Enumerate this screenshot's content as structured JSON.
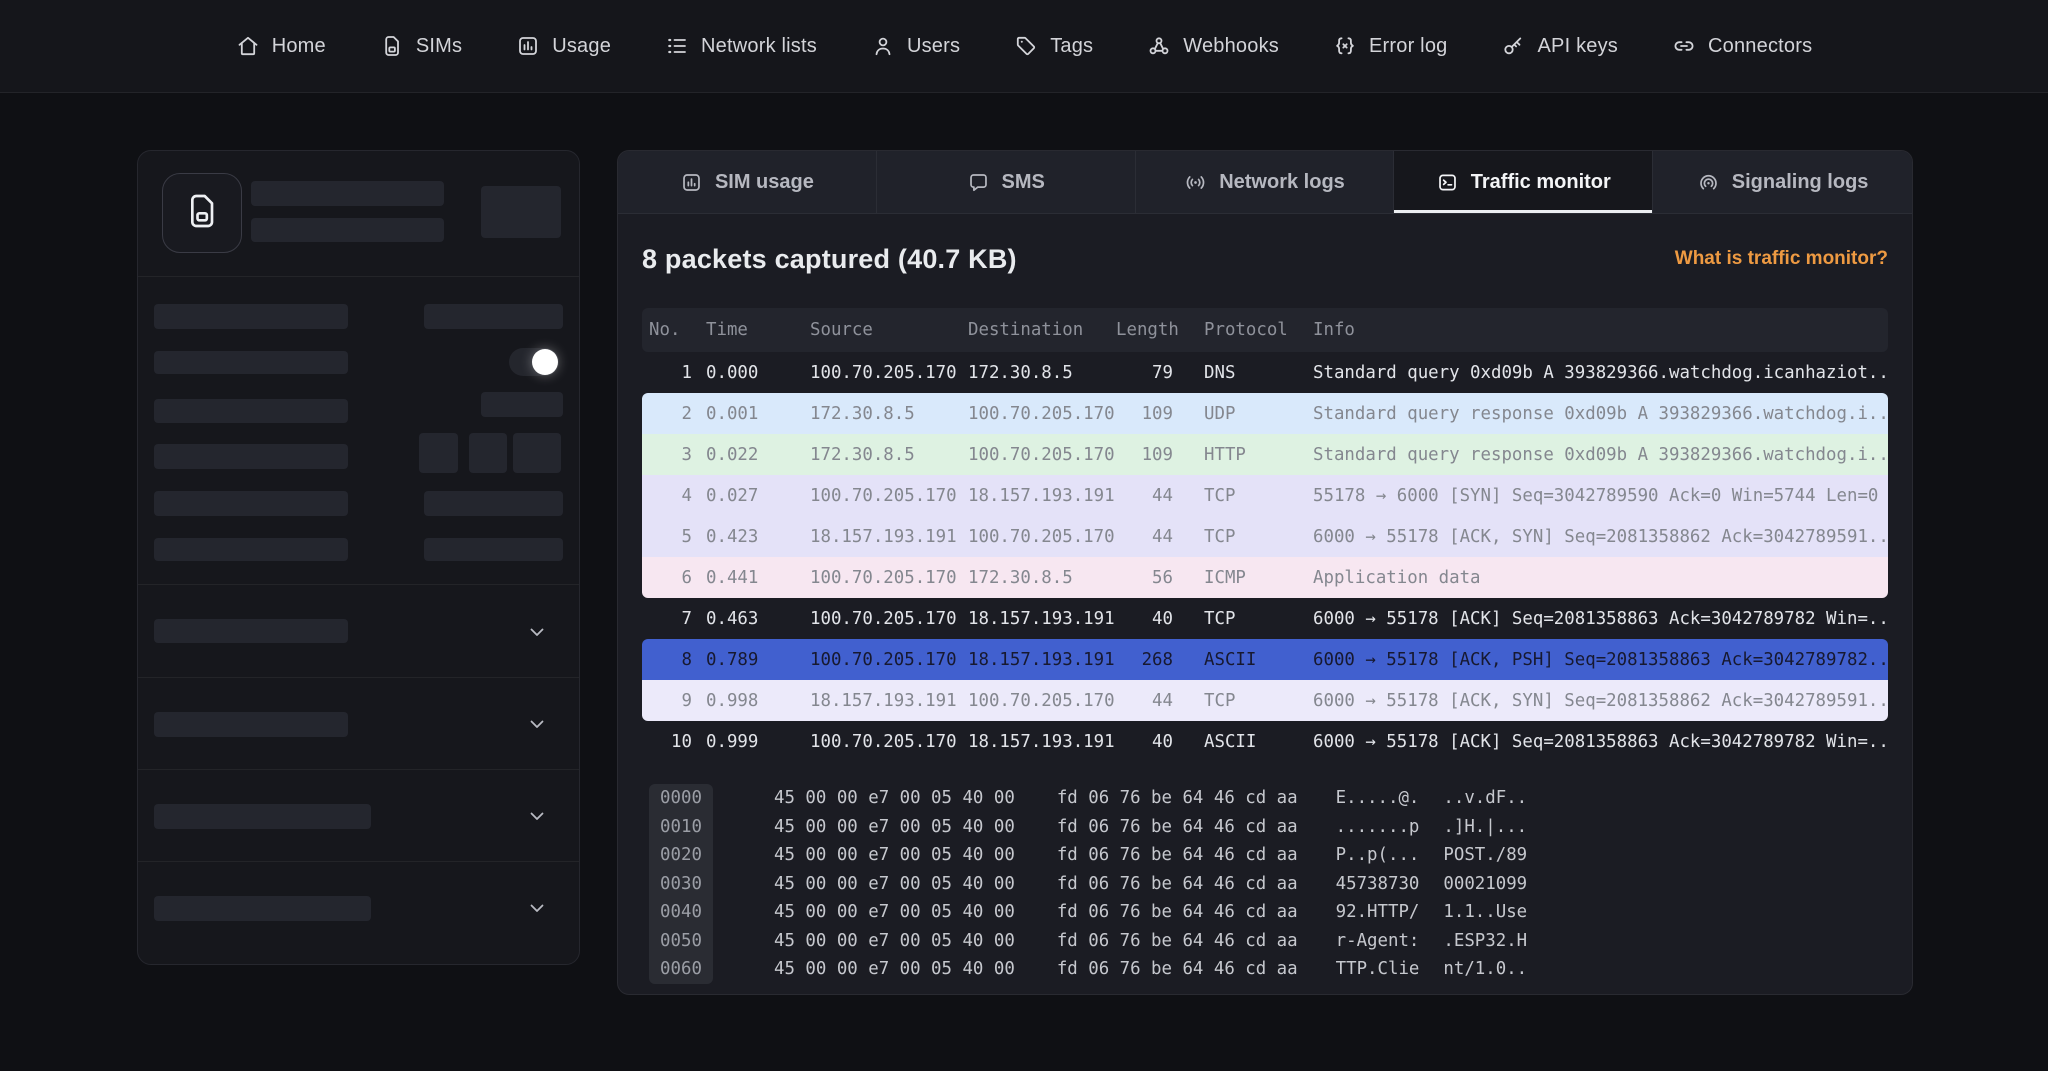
{
  "nav": {
    "items": [
      {
        "label": "Home",
        "icon": "home-icon"
      },
      {
        "label": "SIMs",
        "icon": "sim-icon"
      },
      {
        "label": "Usage",
        "icon": "usage-icon"
      },
      {
        "label": "Network lists",
        "icon": "network-lists-icon"
      },
      {
        "label": "Users",
        "icon": "users-icon"
      },
      {
        "label": "Tags",
        "icon": "tag-icon"
      },
      {
        "label": "Webhooks",
        "icon": "webhook-icon"
      },
      {
        "label": "Error log",
        "icon": "error-log-icon"
      },
      {
        "label": "API keys",
        "icon": "key-icon"
      },
      {
        "label": "Connectors",
        "icon": "connector-icon"
      }
    ]
  },
  "tabs": [
    {
      "label": "SIM usage",
      "icon": "sim-usage-icon",
      "active": false
    },
    {
      "label": "SMS",
      "icon": "sms-icon",
      "active": false
    },
    {
      "label": "Network logs",
      "icon": "network-logs-icon",
      "active": false
    },
    {
      "label": "Traffic monitor",
      "icon": "traffic-monitor-icon",
      "active": true
    },
    {
      "label": "Signaling logs",
      "icon": "signaling-logs-icon",
      "active": false
    }
  ],
  "traffic": {
    "summary": "8 packets captured (40.7 KB)",
    "help_link": "What is traffic monitor?",
    "table": {
      "columns": [
        "No.",
        "Time",
        "Source",
        "Destination",
        "Length",
        "Protocol",
        "Info"
      ],
      "rows": [
        {
          "no": "1",
          "time": "0.000",
          "source": "100.70.205.170",
          "destination": "172.30.8.5",
          "length": "79",
          "protocol": "DNS",
          "info": "Standard query 0xd09b A 393829366.watchdog.icanhaziot...",
          "variant": "dark"
        },
        {
          "no": "2",
          "time": "0.001",
          "source": "172.30.8.5",
          "destination": "100.70.205.170",
          "length": "109",
          "protocol": "UDP",
          "info": "Standard query response 0xd09b A 393829366.watchdog.i...",
          "variant": "blue"
        },
        {
          "no": "3",
          "time": "0.022",
          "source": "172.30.8.5",
          "destination": "100.70.205.170",
          "length": "109",
          "protocol": "HTTP",
          "info": "Standard query response 0xd09b A 393829366.watchdog.i...",
          "variant": "green"
        },
        {
          "no": "4",
          "time": "0.027",
          "source": "100.70.205.170",
          "destination": "18.157.193.191",
          "length": "44",
          "protocol": "TCP",
          "info": "55178 → 6000 [SYN] Seq=3042789590 Ack=0 Win=5744 Len=0",
          "variant": "lavender"
        },
        {
          "no": "5",
          "time": "0.423",
          "source": "18.157.193.191",
          "destination": "100.70.205.170",
          "length": "44",
          "protocol": "TCP",
          "info": "6000 → 55178 [ACK, SYN] Seq=2081358862 Ack=3042789591...",
          "variant": "lavender"
        },
        {
          "no": "6",
          "time": "0.441",
          "source": "100.70.205.170",
          "destination": "172.30.8.5",
          "length": "56",
          "protocol": "ICMP",
          "info": "Application data",
          "variant": "pink"
        },
        {
          "no": "7",
          "time": "0.463",
          "source": "100.70.205.170",
          "destination": "18.157.193.191",
          "length": "40",
          "protocol": "TCP",
          "info": "6000 → 55178 [ACK] Seq=2081358863 Ack=3042789782 Win=...",
          "variant": "dark"
        },
        {
          "no": "8",
          "time": "0.789",
          "source": "100.70.205.170",
          "destination": "18.157.193.191",
          "length": "268",
          "protocol": "ASCII",
          "info": "6000 → 55178 [ACK, PSH] Seq=2081358863 Ack=3042789782...",
          "variant": "selected"
        },
        {
          "no": "9",
          "time": "0.998",
          "source": "18.157.193.191",
          "destination": "100.70.205.170",
          "length": "44",
          "protocol": "TCP",
          "info": "6000 → 55178 [ACK, SYN] Seq=2081358862 Ack=3042789591...",
          "variant": "lilac"
        },
        {
          "no": "10",
          "time": "0.999",
          "source": "100.70.205.170",
          "destination": "18.157.193.191",
          "length": "40",
          "protocol": "ASCII",
          "info": "6000 → 55178 [ACK] Seq=2081358863 Ack=3042789782 Win=...",
          "variant": "dark"
        }
      ]
    },
    "hexdump": {
      "rows": [
        {
          "offset": "0000",
          "hex1": "45 00 00 e7 00 05 40 00",
          "hex2": "fd 06 76 be 64 46 cd aa",
          "ascii1": "E.....@.",
          "ascii2": "..v.dF.."
        },
        {
          "offset": "0010",
          "hex1": "45 00 00 e7 00 05 40 00",
          "hex2": "fd 06 76 be 64 46 cd aa",
          "ascii1": ".......p",
          "ascii2": ".]H.|..."
        },
        {
          "offset": "0020",
          "hex1": "45 00 00 e7 00 05 40 00",
          "hex2": "fd 06 76 be 64 46 cd aa",
          "ascii1": "P..p(...",
          "ascii2": "POST./89"
        },
        {
          "offset": "0030",
          "hex1": "45 00 00 e7 00 05 40 00",
          "hex2": "fd 06 76 be 64 46 cd aa",
          "ascii1": "45738730",
          "ascii2": "00021099"
        },
        {
          "offset": "0040",
          "hex1": "45 00 00 e7 00 05 40 00",
          "hex2": "fd 06 76 be 64 46 cd aa",
          "ascii1": "92.HTTP/",
          "ascii2": "1.1..Use"
        },
        {
          "offset": "0050",
          "hex1": "45 00 00 e7 00 05 40 00",
          "hex2": "fd 06 76 be 64 46 cd aa",
          "ascii1": "r-Agent:",
          "ascii2": ".ESP32.H"
        },
        {
          "offset": "0060",
          "hex1": "45 00 00 e7 00 05 40 00",
          "hex2": "fd 06 76 be 64 46 cd aa",
          "ascii1": "TTP.Clie",
          "ascii2": "nt/1.0.."
        }
      ]
    }
  },
  "colors": {
    "accent_link": "#ee9a42",
    "selected_row": "#4160cf",
    "row_blue": "#d9e9fb",
    "row_green": "#def2e2",
    "row_lavender": "#e4e2f8",
    "row_pink": "#f7e7f1",
    "row_lilac": "#eceafa",
    "panel_bg": "#1b1c23",
    "page_bg": "#0f1014"
  }
}
